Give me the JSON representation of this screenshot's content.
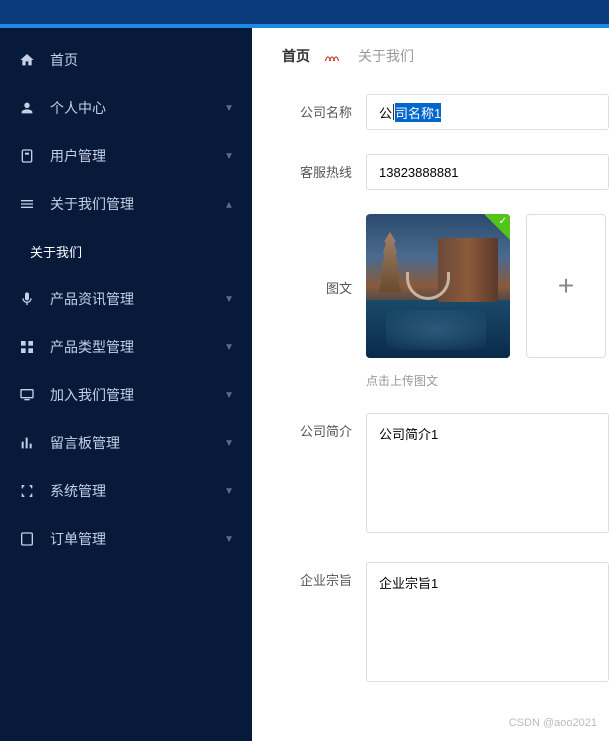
{
  "sidebar": {
    "items": [
      {
        "icon": "home",
        "label": "首页",
        "hasChildren": false
      },
      {
        "icon": "user",
        "label": "个人中心",
        "hasChildren": true
      },
      {
        "icon": "users",
        "label": "用户管理",
        "hasChildren": true
      },
      {
        "icon": "about",
        "label": "关于我们管理",
        "hasChildren": true,
        "expanded": true,
        "children": [
          {
            "label": "关于我们"
          }
        ]
      },
      {
        "icon": "mic",
        "label": "产品资讯管理",
        "hasChildren": true
      },
      {
        "icon": "grid",
        "label": "产品类型管理",
        "hasChildren": true
      },
      {
        "icon": "monitor",
        "label": "加入我们管理",
        "hasChildren": true
      },
      {
        "icon": "chart",
        "label": "留言板管理",
        "hasChildren": true
      },
      {
        "icon": "bracket",
        "label": "系统管理",
        "hasChildren": true
      },
      {
        "icon": "list",
        "label": "订单管理",
        "hasChildren": true
      }
    ]
  },
  "breadcrumb": {
    "home": "首页",
    "current": "关于我们"
  },
  "form": {
    "companyName": {
      "label": "公司名称",
      "prefix": "公",
      "selected": "司名称1"
    },
    "hotline": {
      "label": "客服热线",
      "value": "13823888881"
    },
    "imageText": {
      "label": "图文",
      "hint": "点击上传图文"
    },
    "intro": {
      "label": "公司简介",
      "value": "公司简介1"
    },
    "purpose": {
      "label": "企业宗旨",
      "value": "企业宗旨1"
    }
  },
  "watermark": "CSDN @aoo2021"
}
